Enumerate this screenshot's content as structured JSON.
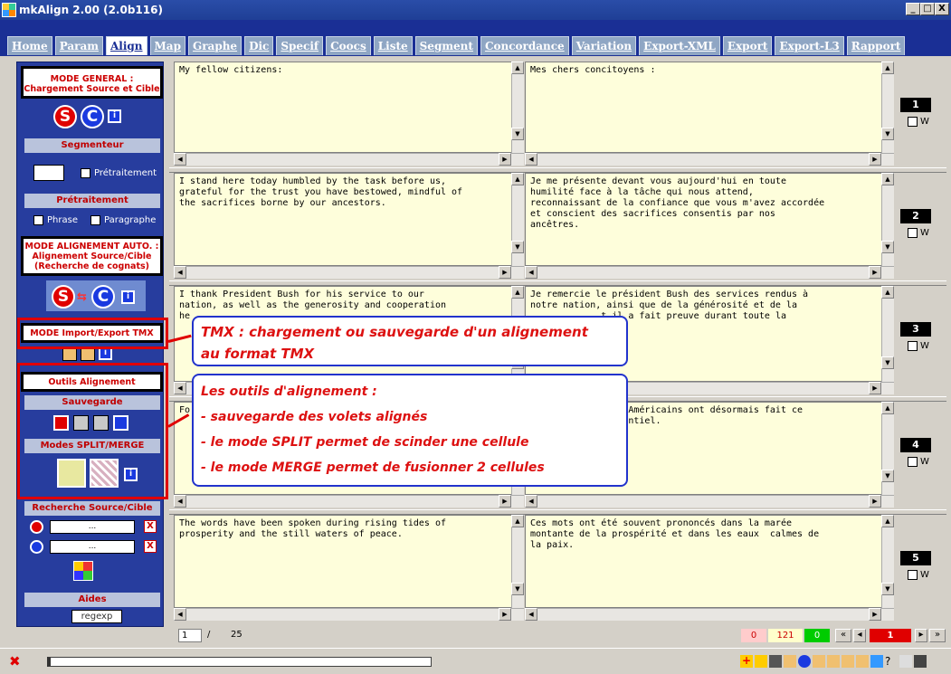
{
  "window": {
    "title": "mkAlign 2.00 (2.0b116)",
    "min": "_",
    "max": "□",
    "close": "X"
  },
  "tabs": [
    "Home",
    "Param",
    "Align",
    "Map",
    "Graphe",
    "Dic",
    "Specif",
    "Coocs",
    "Liste",
    "Segment",
    "Concordance",
    "Variation",
    "Export-XML",
    "Export",
    "Export-L3",
    "Rapport"
  ],
  "active_tab": "Align",
  "left": {
    "mode_general": "MODE GENERAL : Chargement Source et Cible",
    "btn_s": "S",
    "btn_c": "C",
    "info": "i",
    "segmenteur": "Segmenteur",
    "pretraitement_chk": "Prétraitement",
    "pretraitement": "Prétraitement",
    "phrase": "Phrase",
    "paragraphe": "Paragraphe",
    "mode_align": "MODE ALIGNEMENT AUTO. : Alignement Source/Cible (Recherche de cognats)",
    "mode_tmx": "MODE Import/Export TMX",
    "outils": "Outils Alignement",
    "sauvegarde": "Sauvegarde",
    "split_merge": "Modes SPLIT/MERGE",
    "recherche": "Recherche Source/Cible",
    "search_src": "...",
    "search_tgt": "...",
    "x": "X",
    "aides": "Aides",
    "regexp": "regexp"
  },
  "rows": [
    {
      "num": "1",
      "src": "My fellow citizens:",
      "tgt": "Mes chers concitoyens :"
    },
    {
      "num": "2",
      "src": "I stand here today humbled by the task before us,\ngrateful for the trust you have bestowed, mindful of\nthe sacrifices borne by our ancestors.",
      "tgt": "Je me présente devant vous aujourd'hui en toute\nhumilité face à la tâche qui nous attend,\nreconnaissant de la confiance que vous m'avez accordée\net conscient des sacrifices consentis par nos\nancêtres."
    },
    {
      "num": "3",
      "src": "I thank President Bush for his service to our\nnation, as well as the generosity and cooperation\nhe",
      "tgt": "Je remercie le président Bush des services rendus à\nnotre nation, ainsi que de la générosité et de la\n             t il a fait preuve durant toute la"
    },
    {
      "num": "4",
      "src": "Fo",
      "tgt": "                  Américains ont désormais fait ce\n                  ntiel."
    },
    {
      "num": "5",
      "src": "The words have been spoken during rising tides of\nprosperity and the still waters of peace.",
      "tgt": "Ces mots ont été souvent prononcés dans la marée\nmontante de la prospérité et dans les eaux  calmes de\nla paix."
    }
  ],
  "w_label": "W",
  "callout_tmx": {
    "line1": "TMX : chargement ou sauvegarde d'un alignement",
    "line2": "au format TMX"
  },
  "callout_outils": {
    "title": "Les outils d'alignement :",
    "b1": "- sauvegarde des volets alignés",
    "b2": "- le mode SPLIT permet de scinder une cellule",
    "b3": "- le mode MERGE permet de fusionner 2 cellules"
  },
  "nav": {
    "page": "1",
    "sep": "/",
    "total": "25",
    "z1": "0",
    "count": "121",
    "z2": "0",
    "first": "«",
    "prev": "◂",
    "current": "1",
    "next": "▸",
    "last": "»"
  },
  "colors": {
    "accent": "#1a2f95",
    "cell_bg": "#fefedb",
    "highlight": "#e00000"
  }
}
